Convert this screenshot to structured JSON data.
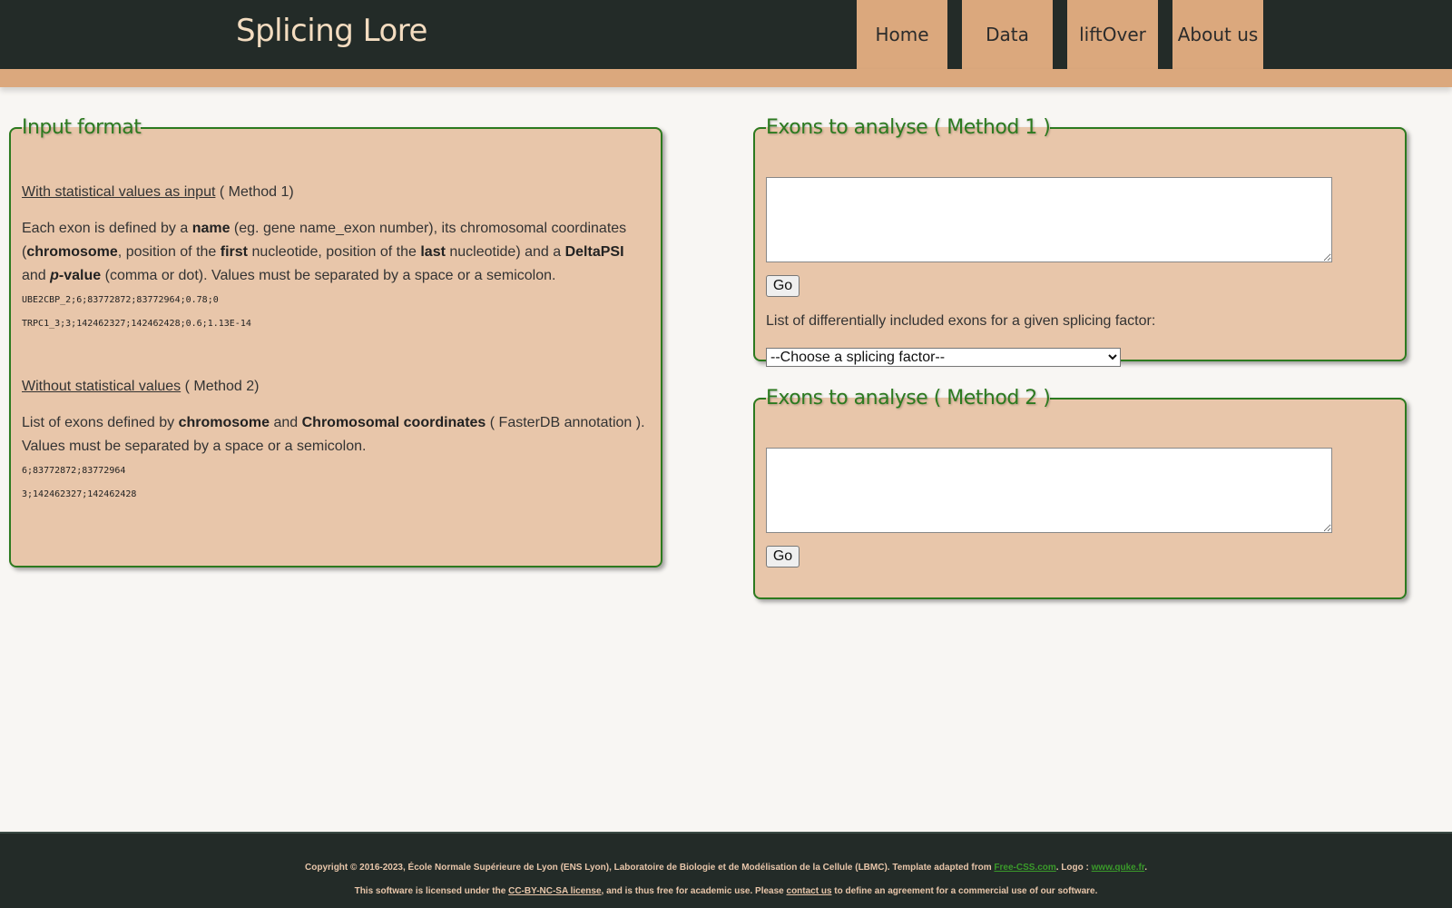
{
  "header": {
    "logo": "Splicing Lore",
    "nav": [
      {
        "label": "Home"
      },
      {
        "label": "Data"
      },
      {
        "label": "liftOver"
      },
      {
        "label": "About us"
      }
    ]
  },
  "input_format": {
    "legend": "Input format",
    "method1": {
      "title": "With statistical values as input",
      "suffix": " ( Method 1)",
      "desc": {
        "t1": "Each exon is defined by a ",
        "b1": "name",
        "t2": " (eg. gene name_exon number), its chromosomal coordinates (",
        "b2": "chromosome",
        "t3": ", position of the ",
        "b3": "first",
        "t4": " nucleotide, position of the ",
        "b4": "last",
        "t5": " nucleotide) and a ",
        "b5": "DeltaPSI",
        "t6": " and ",
        "b6i": "p",
        "b6": "-value",
        "t7": " (comma or dot). Values must be separated by a space or a semicolon."
      },
      "examples": [
        "UBE2CBP_2;6;83772872;83772964;0.78;0",
        "TRPC1_3;3;142462327;142462428;0.6;1.13E-14"
      ]
    },
    "method2": {
      "title": "Without statistical values",
      "suffix": " ( Method 2)",
      "desc": {
        "t1": "List of exons defined by ",
        "b1": "chromosome",
        "t2": " and ",
        "b2": "Chromosomal coordinates",
        "t3": " ( FasterDB annotation ). Values must be separated by a space or a semicolon."
      },
      "examples": [
        "6;83772872;83772964",
        "3;142462327;142462428"
      ]
    }
  },
  "method1_panel": {
    "legend": "Exons to analyse ( Method 1 )",
    "textarea_value": "",
    "go_label": "Go",
    "list_label": "List of differentially included exons for a given splicing factor:",
    "select_selected": "--Choose a splicing factor--"
  },
  "method2_panel": {
    "legend": "Exons to analyse ( Method 2 )",
    "textarea_value": "",
    "go_label": "Go"
  },
  "footer": {
    "line1": {
      "t1": "Copyright © 2016-2023, École Normale Supérieure de Lyon (ENS Lyon), Laboratoire de Biologie et de Modélisation de la Cellule (LBMC). Template adapted from ",
      "link1": "Free-CSS.com",
      "t2": ". Logo : ",
      "link2": "www.quke.fr",
      "t3": "."
    },
    "line2": {
      "t1": "This software is licensed under the ",
      "link1": "CC-BY-NC-SA license",
      "t2": ", and is thus free for academic use. Please ",
      "link2": "contact us",
      "t3": " to define an agreement for a commercial use of our software."
    }
  },
  "colors": {
    "header_bg": "#232b28",
    "accent": "#dba87d",
    "panel_bg": "#e8c6aa",
    "panel_border": "#2c7a1f"
  }
}
